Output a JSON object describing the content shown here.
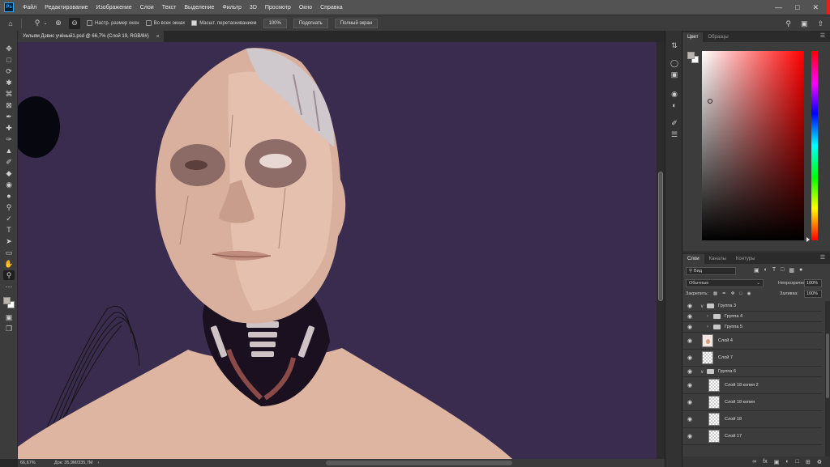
{
  "app": {
    "logo": "Ps",
    "menu": [
      "Файл",
      "Редактирование",
      "Изображение",
      "Слои",
      "Текст",
      "Выделение",
      "Фильтр",
      "3D",
      "Просмотр",
      "Окно",
      "Справка"
    ]
  },
  "options_bar": {
    "icons": [
      "home-icon",
      "zoom-icon",
      "zoom-in-icon",
      "zoom-out-icon"
    ],
    "resize_windows": {
      "label": "Настр. размер окон",
      "checked": false
    },
    "all_windows": {
      "label": "Во всех окнах",
      "checked": false
    },
    "scrubby_zoom": {
      "label": "Масшт. перетаскиванием",
      "checked": true
    },
    "zoom_100": "100%",
    "fit_screen": "Подогнать",
    "full_screen": "Полный экран"
  },
  "document": {
    "tab_title": "Уильям Дэвис учёный1.psd @ 66,7% (Слой 19, RGB/8#)",
    "close": "×"
  },
  "status_bar": {
    "zoom": "66,67%",
    "doc_info": "Док: 35,9M/335,7M",
    "arrow": "›"
  },
  "color_panel": {
    "tabs": [
      "Цвет",
      "Образцы"
    ],
    "active_tab": "Цвет",
    "foreground": "#bcb4ad",
    "background": "#ffffff"
  },
  "layers_panel": {
    "tabs": [
      "Слои",
      "Каналы",
      "Контуры"
    ],
    "active_tab": "Слои",
    "filter": "Вид",
    "blend_mode": "Обычные",
    "opacity_label": "Непрозрачность:",
    "opacity": "100%",
    "lock_label": "Закрепить:",
    "fill_label": "Заливка:",
    "fill": "100%",
    "layers": [
      {
        "name": "Группа 3",
        "kind": "group",
        "indent": 0,
        "expanded": true
      },
      {
        "name": "Группа 4",
        "kind": "group",
        "indent": 1,
        "expanded": false
      },
      {
        "name": "Группа 5",
        "kind": "group",
        "indent": 1,
        "expanded": false
      },
      {
        "name": "Слой 4",
        "kind": "layer",
        "indent": 0,
        "thumb": "face"
      },
      {
        "name": "Слой 7",
        "kind": "layer",
        "indent": 0,
        "thumb": "transparent"
      },
      {
        "name": "Группа 6",
        "kind": "group",
        "indent": 0,
        "expanded": true
      },
      {
        "name": "Слой 18 копия 2",
        "kind": "layer",
        "indent": 1,
        "thumb": "transparent"
      },
      {
        "name": "Слой 18 копия",
        "kind": "layer",
        "indent": 1,
        "thumb": "transparent"
      },
      {
        "name": "Слой 18",
        "kind": "layer",
        "indent": 1,
        "thumb": "transparent"
      },
      {
        "name": "Слой 17",
        "kind": "layer",
        "indent": 1,
        "thumb": "transparent"
      }
    ],
    "bottom_icons": [
      "link-icon",
      "fx-icon",
      "mask-icon",
      "adjustment-icon",
      "folder-icon",
      "new-layer-icon",
      "trash-icon"
    ]
  },
  "canvas": {
    "background_color": "#3a2c4e",
    "skin_color": "#deb5a1"
  }
}
